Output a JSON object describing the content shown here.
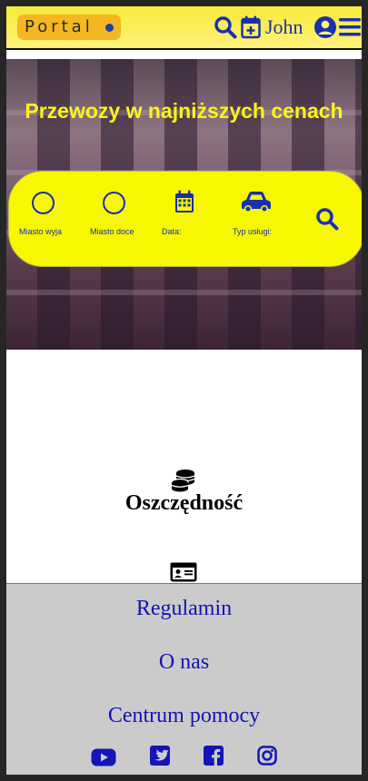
{
  "header": {
    "logo_text": "Portal",
    "user_name": "John",
    "icons": [
      "search-icon",
      "calendar-plus-icon",
      "user-circle-icon",
      "hamburger-menu-icon"
    ]
  },
  "hero": {
    "title": "Przewozy w najniższych cenach"
  },
  "search": {
    "from_label": "Miasto wyja",
    "to_label": "Miasto doce",
    "date_label": "Data:",
    "service_label": "Typ usługi:"
  },
  "feature": {
    "title": "Oszczędność"
  },
  "footer": {
    "links": [
      "Regulamin",
      "O nas",
      "Centrum pomocy"
    ],
    "social": [
      "youtube-icon",
      "twitter-icon",
      "facebook-icon",
      "instagram-icon"
    ]
  },
  "colors": {
    "accent_yellow": "#f7f700",
    "link_blue": "#1414b8",
    "icon_blue": "#1a2fb0",
    "footer_bg": "#cbcbcb"
  }
}
